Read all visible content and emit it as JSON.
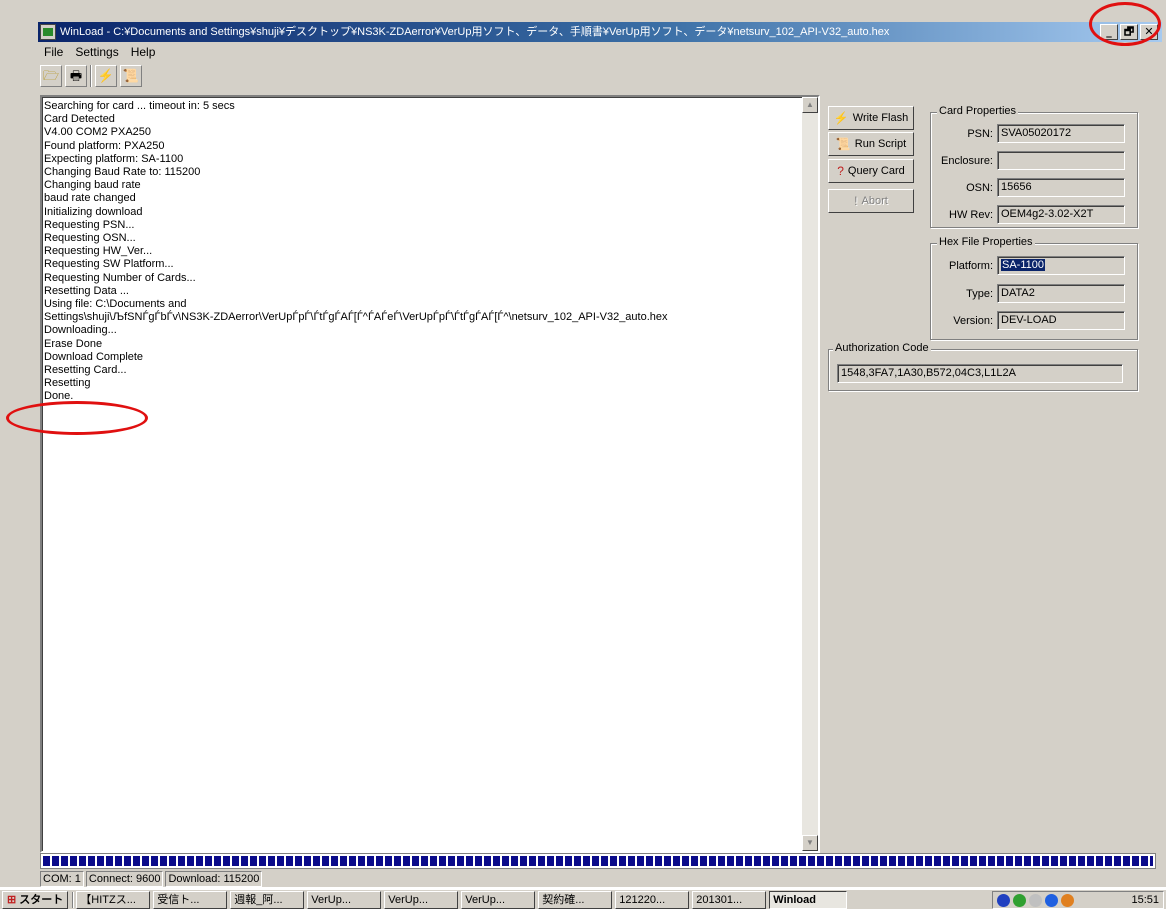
{
  "window": {
    "title": "WinLoad - C:¥Documents and Settings¥shuji¥デスクトップ¥NS3K-ZDAerror¥VerUp用ソフト、データ、手順書¥VerUp用ソフト、データ¥netsurv_102_API-V32_auto.hex",
    "minimize": "_",
    "restore": "🗗",
    "close": "✕"
  },
  "menu": [
    "File",
    "Settings",
    "Help"
  ],
  "toolbar": {
    "open": "🗁",
    "print": "🖶",
    "flash": "⚡",
    "script": "📜"
  },
  "log": {
    "lines": [
      "Searching for card ... timeout in: 5 secs",
      "Card Detected",
      "V4.00 COM2 PXA250",
      "Found platform: PXA250",
      "Expecting platform: SA-1100",
      "Changing Baud Rate to: 115200",
      "Changing baud rate",
      "baud rate changed",
      "Initializing download",
      "Requesting PSN...",
      "Requesting OSN...",
      "Requesting HW_Ver...",
      "Requesting SW Platform...",
      "Requesting Number of Cards...",
      "Resetting Data ...",
      "Using file: C:\\Documents and",
      "Settings\\shuji\\ЉfЅNЃgЃbЃv\\NS3K-ZDAerror\\VerUpЃpЃ\\ЃtЃgЃAЃ[Ѓ^ЃAЃeЃ\\VerUpЃpЃ\\ЃtЃgЃAЃ[Ѓ^\\netsurv_102_API-V32_auto.hex",
      "Downloading...",
      "Erase Done",
      "Download Complete",
      "Resetting Card...",
      "Resetting",
      "Done."
    ]
  },
  "buttons": {
    "write_flash": "Write Flash",
    "run_script": "Run Script",
    "query_card": "Query Card",
    "abort": "Abort"
  },
  "card_properties": {
    "title": "Card Properties",
    "psn_label": "PSN:",
    "psn": "SVA05020172",
    "enclosure_label": "Enclosure:",
    "enclosure": "",
    "osn_label": "OSN:",
    "osn": "15656",
    "hwrev_label": "HW Rev:",
    "hwrev": "OEM4g2-3.02-X2T"
  },
  "hex_properties": {
    "title": "Hex File Properties",
    "platform_label": "Platform:",
    "platform": "SA-1100",
    "type_label": "Type:",
    "type": "DATA2",
    "version_label": "Version:",
    "version": "DEV-LOAD"
  },
  "authorization": {
    "title": "Authorization Code",
    "code": "1548,3FA7,1A30,B572,04C3,L1L2A"
  },
  "progress": 1.0,
  "status": {
    "com": "COM: 1",
    "connect": "Connect: 9600",
    "download": "Download: 115200"
  },
  "taskbar": {
    "start": "スタート",
    "tasks": [
      "【HITZス...",
      "受信ト...",
      "週報_阿...",
      "VerUp...",
      "VerUp...",
      "VerUp...",
      "契約確...",
      "121220...",
      "201301..."
    ],
    "active_task": "Winload",
    "clock": "15:51"
  },
  "colors": {
    "title_bar": "#0a246a",
    "progress": "#0a0a8a",
    "annotation_ring": "#e01010",
    "selection": "#0a246a"
  }
}
